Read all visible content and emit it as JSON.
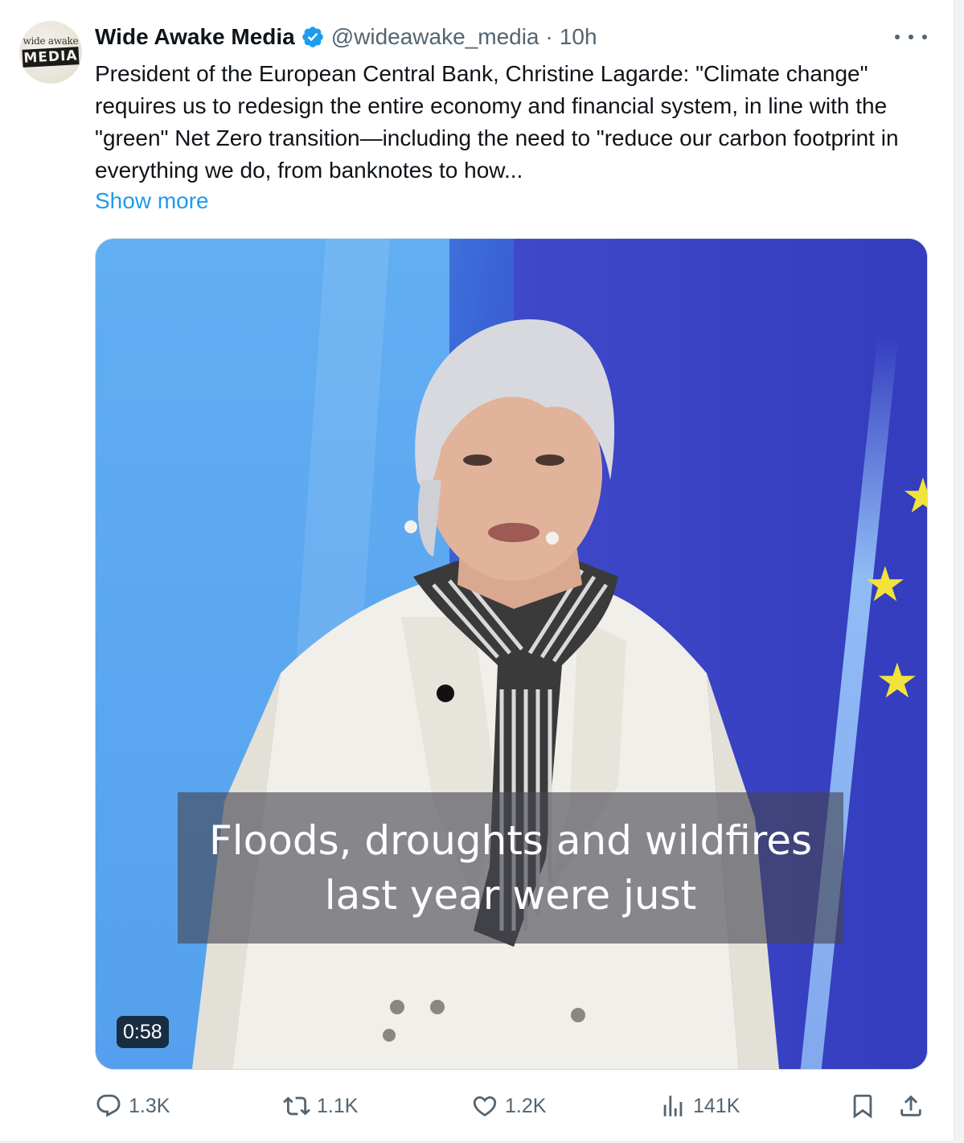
{
  "tweet": {
    "author": {
      "avatar_top": "wide awake",
      "avatar_bottom": "MEDIA",
      "name": "Wide Awake Media",
      "handle": "@wideawake_media",
      "separator": "·",
      "time": "10h"
    },
    "text": "President of the European Central Bank, Christine Lagarde: \"Climate change\" requires us to redesign the entire economy and financial system, in line with the \"green\" Net Zero transition—including the need to \"reduce our carbon footprint in everything we do, from banknotes to how...",
    "show_more": "Show more",
    "video": {
      "caption_line1": "Floods, droughts and wildfires",
      "caption_line2": "last year were just",
      "duration": "0:58"
    },
    "actions": {
      "replies": "1.3K",
      "reposts": "1.1K",
      "likes": "1.2K",
      "views": "141K"
    },
    "icons": [
      "verified-badge-icon",
      "more-icon",
      "reply-icon",
      "repost-icon",
      "like-icon",
      "views-icon",
      "bookmark-icon",
      "share-icon"
    ],
    "colors": {
      "link": "#1d9bf0",
      "verified": "#1d9bf0",
      "secondary_text": "#536471"
    }
  }
}
